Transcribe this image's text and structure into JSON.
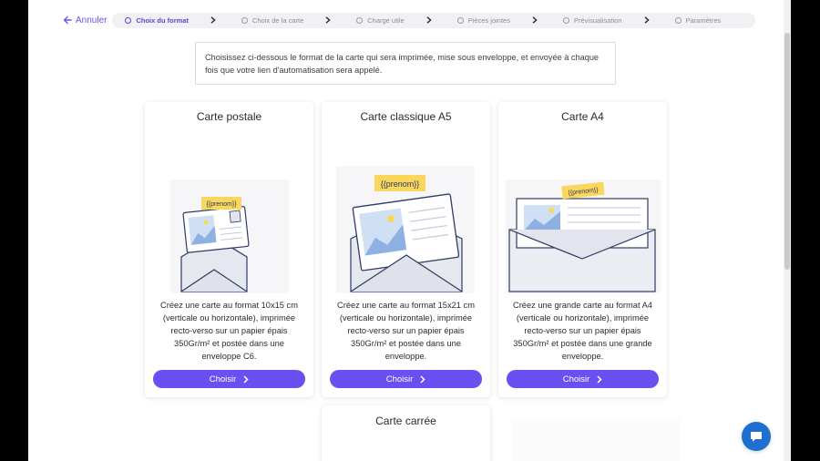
{
  "header": {
    "cancel_label": "Annuler",
    "steps": [
      {
        "label": "Choix du format",
        "active": true
      },
      {
        "label": "Choix de la carte",
        "active": false
      },
      {
        "label": "Charge utile",
        "active": false
      },
      {
        "label": "Pièces jointes",
        "active": false
      },
      {
        "label": "Prévisualisation",
        "active": false
      },
      {
        "label": "Paramètres",
        "active": false
      }
    ]
  },
  "intro_text": "Choisissez ci-dessous le format de la carte qui sera imprimée, mise sous enveloppe, et envoyée à chaque fois que votre lien d'automatisation sera appelé.",
  "cards": [
    {
      "title": "Carte postale",
      "tag": "{{prenom}}",
      "description": "Créez une carte au format 10x15 cm (verticale ou horizontale), imprimée recto-verso sur un papier épais 350Gr/m² et postée dans une enveloppe C6.",
      "button": "Choisir"
    },
    {
      "title": "Carte classique A5",
      "tag": "{{prenom}}",
      "description": "Créez une carte au format 15x21 cm (verticale ou horizontale), imprimée recto-verso sur un papier épais 350Gr/m² et postée dans une enveloppe.",
      "button": "Choisir"
    },
    {
      "title": "Carte A4",
      "tag": "{{prenom}}",
      "description": "Créez une grande carte au format A4 (verticale ou horizontale), imprimée recto-verso sur un papier épais 350Gr/m² et postée dans une grande enveloppe.",
      "button": "Choisir"
    },
    {
      "title": "Carte carrée"
    }
  ],
  "colors": {
    "accent": "#6c4ff0",
    "tag": "#f9d65c",
    "chat": "#1f6fd0"
  },
  "icons": {
    "back": "arrow-left-icon",
    "step_separator": "chevron-right-icon",
    "button": "chevron-right-icon",
    "chat": "chat-icon"
  }
}
